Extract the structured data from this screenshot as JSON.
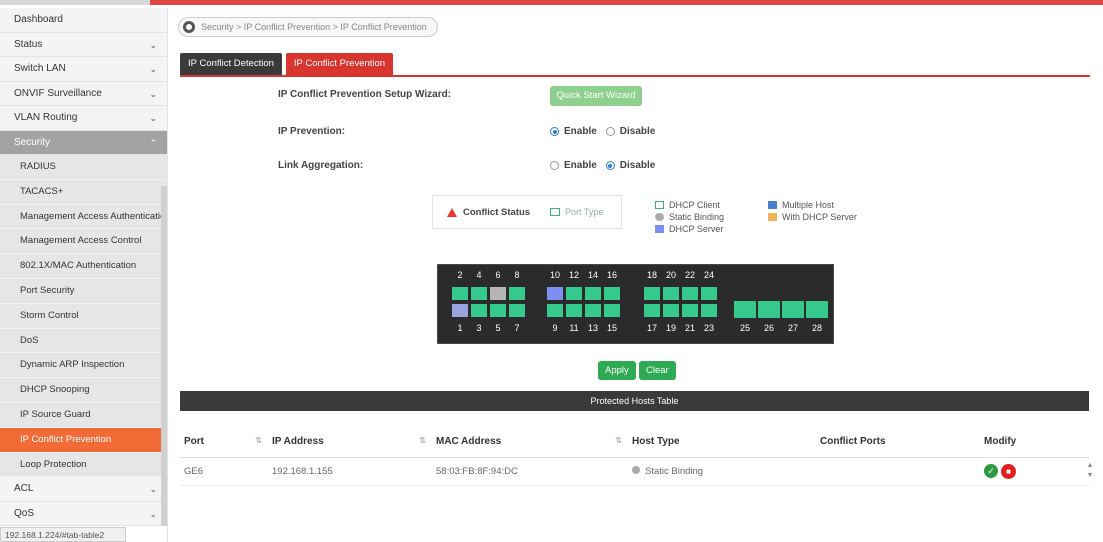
{
  "sidebar": {
    "items": [
      {
        "label": "Dashboard"
      },
      {
        "label": "Status"
      },
      {
        "label": "Switch LAN"
      },
      {
        "label": "ONVIF Surveillance"
      },
      {
        "label": "VLAN Routing"
      },
      {
        "label": "Security"
      }
    ],
    "security_sub": [
      "RADIUS",
      "TACACS+",
      "Management Access Authentication",
      "Management Access Control",
      "802.1X/MAC Authentication",
      "Port Security",
      "Storm Control",
      "DoS",
      "Dynamic ARP Inspection",
      "DHCP Snooping",
      "IP Source Guard",
      "IP Conflict Prevention",
      "Loop Protection"
    ],
    "tail_items": [
      {
        "label": "ACL"
      },
      {
        "label": "QoS"
      }
    ],
    "status_url": "192.168.1.224/#tab-table2"
  },
  "breadcrumb": "Security > IP Conflict Prevention > IP Conflict Prevention",
  "tabs": [
    {
      "label": "IP Conflict Detection",
      "active": false
    },
    {
      "label": "IP Conflict Prevention",
      "active": true
    }
  ],
  "form": {
    "wizard_label": "IP Conflict Prevention Setup Wizard:",
    "wizard_button": "Quick Start Wizard",
    "ip_prevention_label": "IP Prevention:",
    "ip_prevention_value": "Enable",
    "link_agg_label": "Link Aggregation:",
    "link_agg_value": "Disable",
    "enable_text": "Enable",
    "disable_text": "Disable"
  },
  "status_box": {
    "conflict_status": "Conflict Status",
    "port_type": "Port Type"
  },
  "legend": {
    "col1": [
      "DHCP Client",
      "Static Binding",
      "DHCP Server"
    ],
    "col2": [
      "Multiple Host",
      "With DHCP Server"
    ]
  },
  "switch_panel": {
    "top_numbers": [
      "2",
      "4",
      "6",
      "8",
      "10",
      "12",
      "14",
      "16",
      "18",
      "20",
      "22",
      "24"
    ],
    "bottom_numbers": [
      "1",
      "3",
      "5",
      "7",
      "9",
      "11",
      "13",
      "15",
      "17",
      "19",
      "21",
      "23"
    ],
    "sfp_numbers": [
      "25",
      "26",
      "27",
      "28"
    ]
  },
  "actions": {
    "apply": "Apply",
    "clear": "Clear"
  },
  "table": {
    "title": "Protected Hosts Table",
    "columns": [
      "Port",
      "IP Address",
      "MAC Address",
      "Host Type",
      "Conflict Ports",
      "Modify"
    ],
    "rows": [
      {
        "port": "GE6",
        "ip": "192.168.1.155",
        "mac": "58:03:FB:8F:94:DC",
        "host_type": "Static Binding",
        "conflict_ports": ""
      }
    ]
  },
  "colors": {
    "accent_red": "#d9352f",
    "active_orange": "#f26a35",
    "port_green": "#36c98e"
  }
}
